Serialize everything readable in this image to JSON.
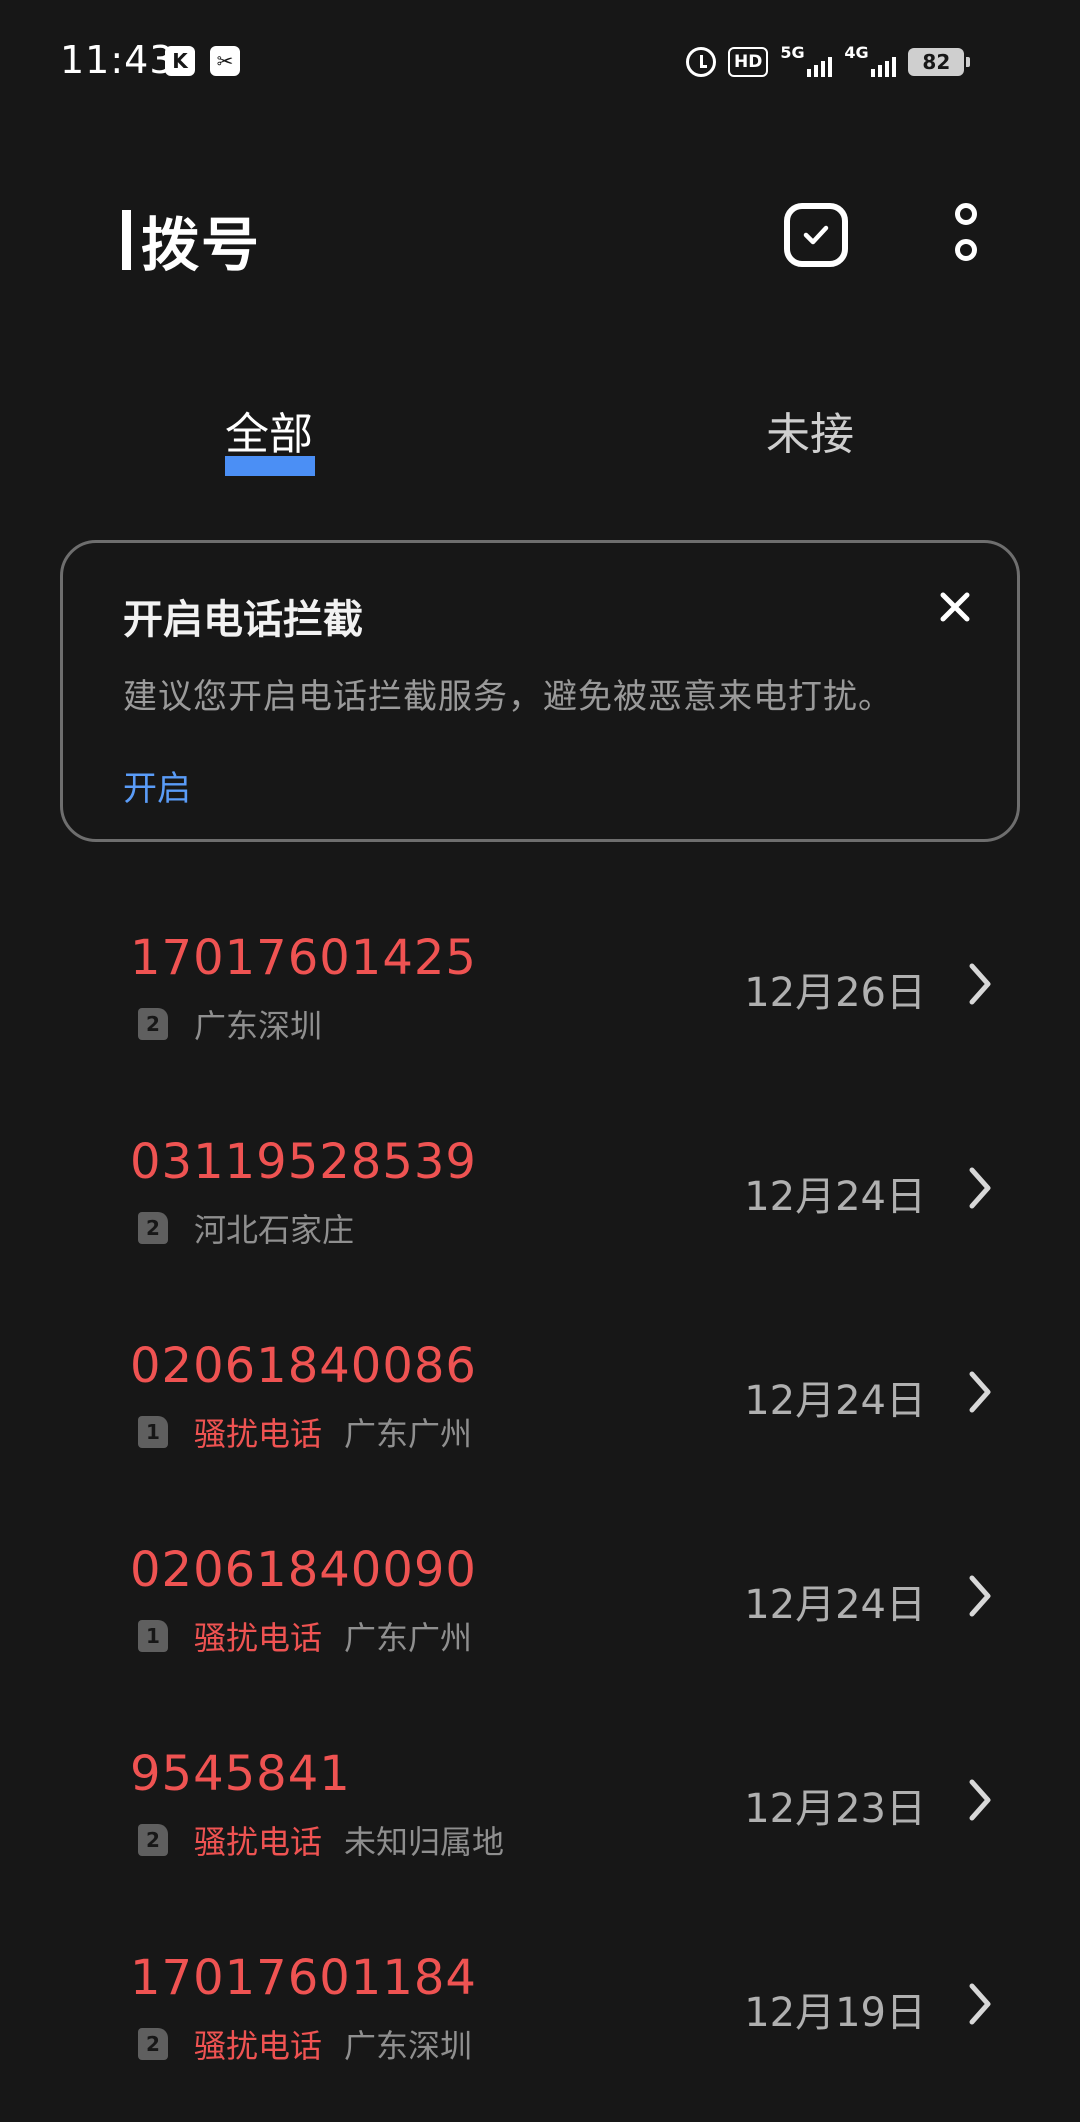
{
  "status_bar": {
    "time": "11:43",
    "app_icons": [
      "K",
      "✂"
    ],
    "hd_label": "HD",
    "net1": "5G",
    "net2": "4G",
    "battery": "82"
  },
  "header": {
    "title": "拨号",
    "select_icon": "checkbox-icon",
    "more_icon": "more-vertical-icon"
  },
  "tabs": [
    {
      "label": "全部",
      "active": true
    },
    {
      "label": "未接",
      "active": false
    }
  ],
  "colors": {
    "accent": "#4b8ff5",
    "missed": "#ef5352",
    "background": "#171717"
  },
  "card": {
    "title": "开启电话拦截",
    "description": "建议您开启电话拦截服务，避免被恶意来电打扰。",
    "action": "开启"
  },
  "calls": [
    {
      "number": "17017601425",
      "sim": "2",
      "tag": "",
      "location": "广东深圳",
      "date": "12月26日"
    },
    {
      "number": "03119528539",
      "sim": "2",
      "tag": "",
      "location": "河北石家庄",
      "date": "12月24日"
    },
    {
      "number": "02061840086",
      "sim": "1",
      "tag": "骚扰电话",
      "location": "广东广州",
      "date": "12月24日"
    },
    {
      "number": "02061840090",
      "sim": "1",
      "tag": "骚扰电话",
      "location": "广东广州",
      "date": "12月24日"
    },
    {
      "number": "9545841",
      "sim": "2",
      "tag": "骚扰电话",
      "location": "未知归属地",
      "date": "12月23日"
    },
    {
      "number": "17017601184",
      "sim": "2",
      "tag": "骚扰电话",
      "location": "广东深圳",
      "date": "12月19日"
    }
  ]
}
